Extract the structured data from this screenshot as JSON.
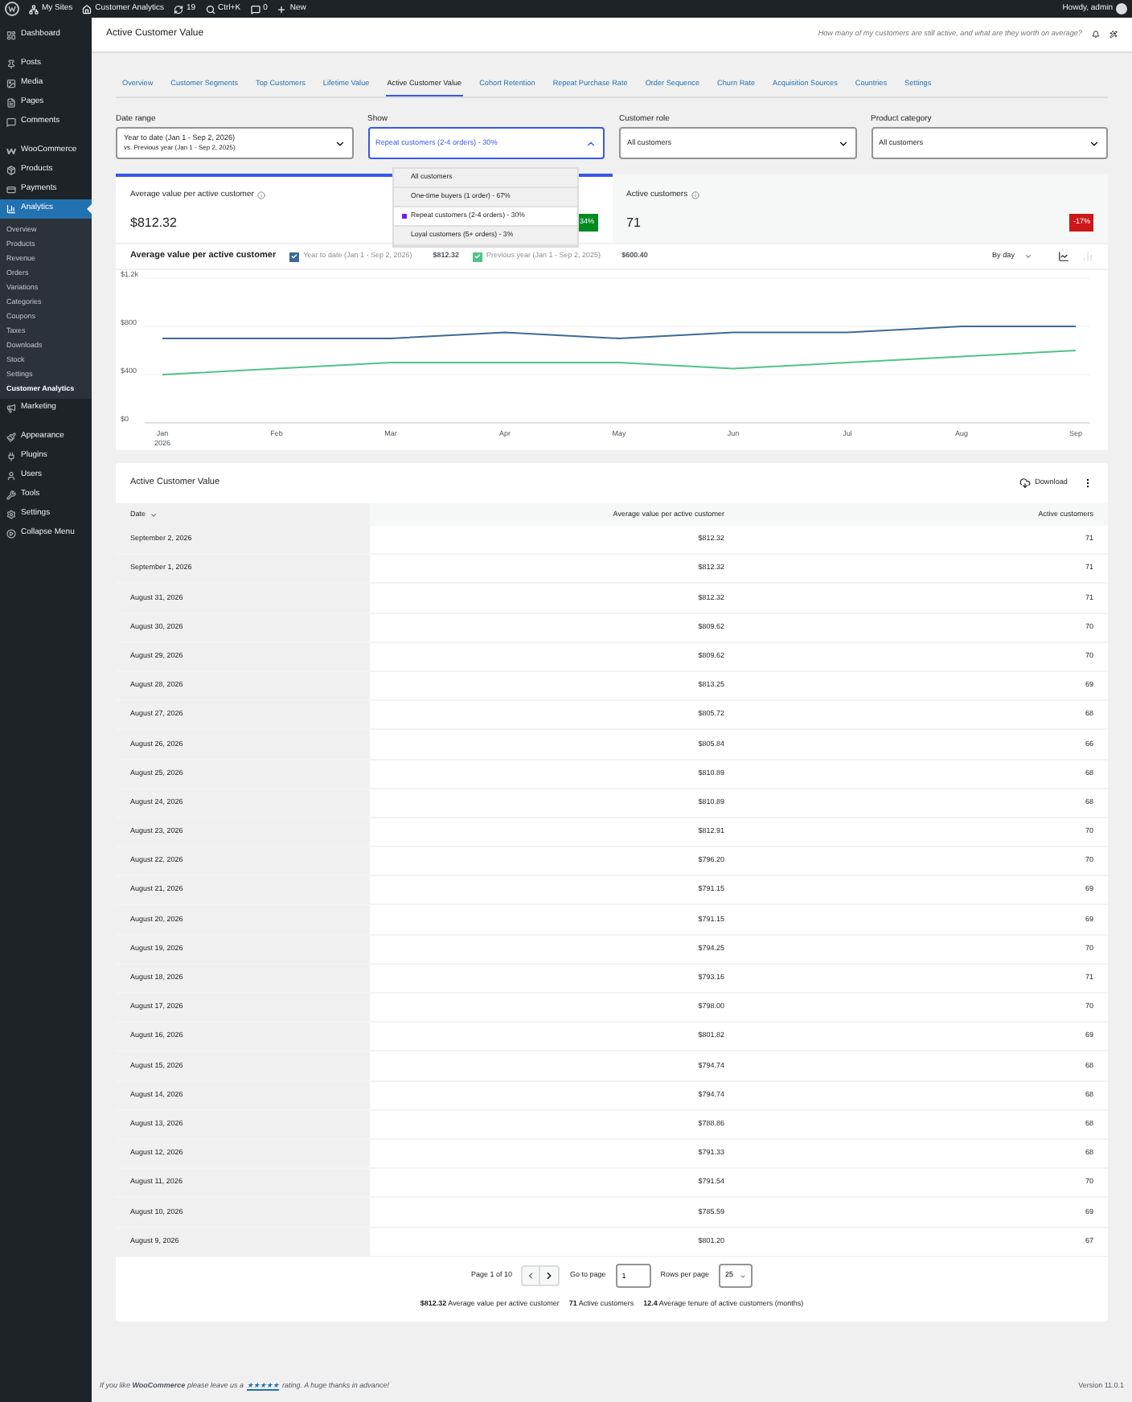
{
  "admin_bar": {
    "items": [
      {
        "kind": "sites",
        "label": "My Sites"
      },
      {
        "kind": "home",
        "label": "Customer Analytics"
      },
      {
        "kind": "updates",
        "label": "19"
      },
      {
        "kind": "search",
        "label": "Ctrl+K"
      },
      {
        "kind": "comments",
        "label": "0"
      },
      {
        "kind": "new",
        "label": "New"
      }
    ],
    "greeting": "Howdy, admin"
  },
  "sidebar": {
    "items": [
      {
        "label": "Dashboard",
        "selected": false
      },
      {
        "label": "Posts",
        "selected": false
      },
      {
        "label": "Media",
        "selected": false
      },
      {
        "label": "Pages",
        "selected": false
      },
      {
        "label": "Comments",
        "selected": false
      },
      {
        "label": "WooCommerce",
        "selected": false
      },
      {
        "label": "Products",
        "selected": false
      },
      {
        "label": "Payments",
        "selected": false
      },
      {
        "label": "Analytics",
        "selected": true,
        "children": [
          {
            "label": "Overview",
            "selected": false
          },
          {
            "label": "Products",
            "selected": false
          },
          {
            "label": "Revenue",
            "selected": false
          },
          {
            "label": "Orders",
            "selected": false
          },
          {
            "label": "Variations",
            "selected": false
          },
          {
            "label": "Categories",
            "selected": false
          },
          {
            "label": "Coupons",
            "selected": false
          },
          {
            "label": "Taxes",
            "selected": false
          },
          {
            "label": "Downloads",
            "selected": false
          },
          {
            "label": "Stock",
            "selected": false
          },
          {
            "label": "Settings",
            "selected": false
          },
          {
            "label": "Customer Analytics",
            "selected": true
          }
        ]
      },
      {
        "label": "Marketing",
        "selected": false
      },
      {
        "label": "Appearance",
        "selected": false
      },
      {
        "label": "Plugins",
        "selected": false
      },
      {
        "label": "Users",
        "selected": false
      },
      {
        "label": "Tools",
        "selected": false
      },
      {
        "label": "Settings",
        "selected": false
      },
      {
        "label": "Collapse Menu",
        "selected": false
      }
    ]
  },
  "header": {
    "title": "Active Customer Value",
    "question": "How many of my customers are still active, and what are they worth on average?"
  },
  "tabs": [
    {
      "label": "Overview",
      "selected": false
    },
    {
      "label": "Customer Segments",
      "selected": false
    },
    {
      "label": "Top Customers",
      "selected": false
    },
    {
      "label": "Lifetime Value",
      "selected": false
    },
    {
      "label": "Active Customer Value",
      "selected": true
    },
    {
      "label": "Cohort Retention",
      "selected": false
    },
    {
      "label": "Repeat Purchase Rate",
      "selected": false
    },
    {
      "label": "Order Sequence",
      "selected": false
    },
    {
      "label": "Churn Rate",
      "selected": false
    },
    {
      "label": "Acquisition Sources",
      "selected": false
    },
    {
      "label": "Countries",
      "selected": false
    },
    {
      "label": "Settings",
      "selected": false
    }
  ],
  "filters": [
    {
      "label": "Date range",
      "value": "Year to date (Jan 1 - Sep 2, 2026)",
      "secondary": "vs. Previous year (Jan 1 - Sep 2, 2025)",
      "expanded": false
    },
    {
      "label": "Show",
      "value": "Repeat customers (2-4 orders) - 30%",
      "expanded": true,
      "options": [
        {
          "label": "All customers",
          "selected": false
        },
        {
          "label": "One-time buyers (1 order) - 67%",
          "selected": false
        },
        {
          "label": "Repeat customers (2-4 orders) - 30%",
          "selected": true
        },
        {
          "label": "Loyal customers (5+ orders) - 3%",
          "selected": false
        }
      ]
    },
    {
      "label": "Customer role",
      "value": "All customers",
      "expanded": false
    },
    {
      "label": "Product category",
      "value": "All customers",
      "expanded": false
    }
  ],
  "kpis": [
    {
      "label": "Average value per active customer",
      "value": "$812.32",
      "delta": "34%",
      "color": "#008a20",
      "selected": true
    },
    {
      "label": "Active customers",
      "value": "71",
      "delta": "-17%",
      "color": "#cc1818",
      "selected": false
    }
  ],
  "chart": {
    "title": "Average value per active customer",
    "legend": [
      {
        "value": "$812.32",
        "checked": true
      },
      {
        "value": "$600.40",
        "checked": true
      }
    ],
    "interval": "By day",
    "chart_types": [
      {
        "kind": "line",
        "selected": true
      },
      {
        "kind": "bar",
        "selected": false
      }
    ],
    "chart_data": {
      "type": "line",
      "categories": [
        "Jan 2026",
        "Feb",
        "Mar",
        "Apr",
        "May",
        "Jun",
        "Jul",
        "Aug",
        "Sep"
      ],
      "series": [
        {
          "name": "Year to date (Jan 1 - Sep 2, 2026)",
          "color": "#3d6a94",
          "values": [
            700,
            700,
            700,
            750,
            700,
            750,
            750,
            800,
            800
          ]
        },
        {
          "name": "Previous year (Jan 1 - Sep 2, 2025)",
          "color": "#4fc38a",
          "values": [
            400,
            450,
            500,
            500,
            500,
            450,
            500,
            550,
            600
          ]
        }
      ],
      "ylim": [
        0,
        1200
      ],
      "yticks": [
        {
          "value": 0,
          "label": "$0"
        },
        {
          "value": 400,
          "label": "$400"
        },
        {
          "value": 800,
          "label": "$800"
        },
        {
          "value": 1200,
          "label": "$1.2k"
        }
      ]
    }
  },
  "table": {
    "title": "Active Customer Value",
    "download": "Download",
    "columns": [
      {
        "label": "Date",
        "sorted": true
      },
      {
        "label": "Average value per active customer",
        "sorted": false
      },
      {
        "label": "Active customers",
        "sorted": false
      }
    ],
    "rows": [
      [
        "September 2, 2026",
        "$812.32",
        "71"
      ],
      [
        "September 1, 2026",
        "$812.32",
        "71"
      ],
      [
        "August 31, 2026",
        "$812.32",
        "71"
      ],
      [
        "August 30, 2026",
        "$809.62",
        "70"
      ],
      [
        "August 29, 2026",
        "$809.62",
        "70"
      ],
      [
        "August 28, 2026",
        "$813.25",
        "69"
      ],
      [
        "August 27, 2026",
        "$805.72",
        "68"
      ],
      [
        "August 26, 2026",
        "$805.84",
        "66"
      ],
      [
        "August 25, 2026",
        "$810.89",
        "68"
      ],
      [
        "August 24, 2026",
        "$810.89",
        "68"
      ],
      [
        "August 23, 2026",
        "$812.91",
        "70"
      ],
      [
        "August 22, 2026",
        "$796.20",
        "70"
      ],
      [
        "August 21, 2026",
        "$791.15",
        "69"
      ],
      [
        "August 20, 2026",
        "$791.15",
        "69"
      ],
      [
        "August 19, 2026",
        "$794.25",
        "70"
      ],
      [
        "August 18, 2026",
        "$793.16",
        "71"
      ],
      [
        "August 17, 2026",
        "$798.00",
        "70"
      ],
      [
        "August 16, 2026",
        "$801.82",
        "69"
      ],
      [
        "August 15, 2026",
        "$794.74",
        "68"
      ],
      [
        "August 14, 2026",
        "$794.74",
        "68"
      ],
      [
        "August 13, 2026",
        "$788.86",
        "68"
      ],
      [
        "August 12, 2026",
        "$791.33",
        "68"
      ],
      [
        "August 11, 2026",
        "$791.54",
        "70"
      ],
      [
        "August 10, 2026",
        "$785.59",
        "69"
      ],
      [
        "August 9, 2026",
        "$801.20",
        "67"
      ]
    ],
    "pagination": {
      "page_label": "Page 1 of 10",
      "goto_label": "Go to page",
      "goto_value": "1",
      "rows_label": "Rows per page",
      "rows_value": "25"
    },
    "summary": [
      "**$812.32** Average value per active customer",
      "**71** Active customers",
      "**12.4** Average tenure of active customers (months)"
    ]
  },
  "footer": {
    "before": "If you like **WooCommerce** please leave us a",
    "link": "★★★★★",
    "after": "rating. A huge thanks in advance!",
    "version": "Version 11.0.1"
  }
}
